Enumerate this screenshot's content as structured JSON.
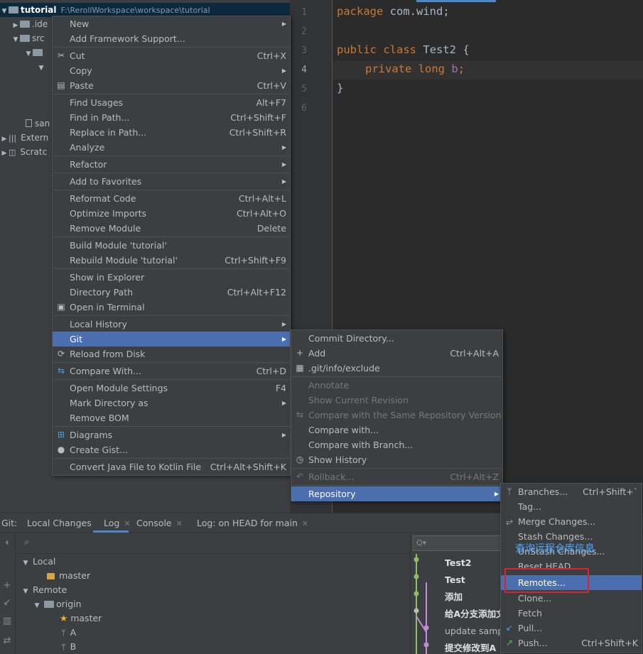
{
  "project": {
    "root_name": "tutorial",
    "root_path": "F:\\RerollWorkspace\\workspace\\tutorial",
    "items": [
      {
        "label": ".ide"
      },
      {
        "label": "src"
      },
      {
        "label": "san"
      },
      {
        "label": "Extern"
      },
      {
        "label": "Scratc"
      }
    ]
  },
  "editor": {
    "line_numbers": [
      "1",
      "2",
      "3",
      "4",
      "5",
      "6"
    ],
    "line1_kw": "package",
    "line1_rest": " com.wind;",
    "line3_kw1": "public",
    "line3_kw2": "class",
    "line3_name": "Test2",
    "line3_brace": " {",
    "line4_kw1": "private",
    "line4_kw2": "long",
    "line4_field": "b",
    "line4_end": ";",
    "line5": "}"
  },
  "main_menu": {
    "items": [
      {
        "label": "New",
        "shortcut": "",
        "submenu": true
      },
      {
        "label": "Add Framework Support...",
        "shortcut": ""
      },
      {
        "label": "Cut",
        "shortcut": "Ctrl+X",
        "icon": "scissors-icon"
      },
      {
        "label": "Copy",
        "shortcut": "",
        "submenu": true
      },
      {
        "label": "Paste",
        "shortcut": "Ctrl+V",
        "icon": "clipboard-icon"
      },
      {
        "label": "Find Usages",
        "shortcut": "Alt+F7"
      },
      {
        "label": "Find in Path...",
        "shortcut": "Ctrl+Shift+F"
      },
      {
        "label": "Replace in Path...",
        "shortcut": "Ctrl+Shift+R"
      },
      {
        "label": "Analyze",
        "shortcut": "",
        "submenu": true
      },
      {
        "label": "Refactor",
        "shortcut": "",
        "submenu": true
      },
      {
        "label": "Add to Favorites",
        "shortcut": "",
        "submenu": true
      },
      {
        "label": "Reformat Code",
        "shortcut": "Ctrl+Alt+L"
      },
      {
        "label": "Optimize Imports",
        "shortcut": "Ctrl+Alt+O"
      },
      {
        "label": "Remove Module",
        "shortcut": "Delete"
      },
      {
        "label": "Build Module 'tutorial'",
        "shortcut": ""
      },
      {
        "label": "Rebuild Module 'tutorial'",
        "shortcut": "Ctrl+Shift+F9"
      },
      {
        "label": "Show in Explorer",
        "shortcut": ""
      },
      {
        "label": "Directory Path",
        "shortcut": "Ctrl+Alt+F12"
      },
      {
        "label": "Open in Terminal",
        "shortcut": "",
        "icon": "terminal-icon"
      },
      {
        "label": "Local History",
        "shortcut": "",
        "submenu": true
      },
      {
        "label": "Git",
        "shortcut": "",
        "submenu": true,
        "selected": true
      },
      {
        "label": "Reload from Disk",
        "shortcut": "",
        "icon": "reload-icon"
      },
      {
        "label": "Compare With...",
        "shortcut": "Ctrl+D",
        "icon": "compare-icon"
      },
      {
        "label": "Open Module Settings",
        "shortcut": "F4"
      },
      {
        "label": "Mark Directory as",
        "shortcut": "",
        "submenu": true
      },
      {
        "label": "Remove BOM",
        "shortcut": ""
      },
      {
        "label": "Diagrams",
        "shortcut": "",
        "submenu": true,
        "icon": "diagram-icon"
      },
      {
        "label": "Create Gist...",
        "shortcut": "",
        "icon": "github-icon"
      },
      {
        "label": "Convert Java File to Kotlin File",
        "shortcut": "Ctrl+Alt+Shift+K"
      }
    ]
  },
  "git_menu": {
    "items": [
      {
        "label": "Commit Directory...",
        "shortcut": ""
      },
      {
        "label": "Add",
        "shortcut": "Ctrl+Alt+A",
        "icon": "plus-icon"
      },
      {
        "label": ".git/info/exclude",
        "shortcut": "",
        "icon": "git-file-icon"
      },
      {
        "label": "Annotate",
        "shortcut": "",
        "disabled": true
      },
      {
        "label": "Show Current Revision",
        "shortcut": "",
        "disabled": true
      },
      {
        "label": "Compare with the Same Repository Version",
        "shortcut": "",
        "disabled": true,
        "icon": "compare-icon"
      },
      {
        "label": "Compare with...",
        "shortcut": ""
      },
      {
        "label": "Compare with Branch...",
        "shortcut": ""
      },
      {
        "label": "Show History",
        "shortcut": "",
        "icon": "clock-icon"
      },
      {
        "label": "Rollback...",
        "shortcut": "Ctrl+Alt+Z",
        "disabled": true,
        "icon": "rollback-icon"
      },
      {
        "label": "Repository",
        "shortcut": "",
        "submenu": true,
        "selected": true
      }
    ]
  },
  "repo_menu": {
    "items": [
      {
        "label": "Branches...",
        "shortcut": "Ctrl+Shift+`",
        "icon": "branch-icon"
      },
      {
        "label": "Tag...",
        "shortcut": ""
      },
      {
        "label": "Merge Changes...",
        "shortcut": "",
        "icon": "merge-icon"
      },
      {
        "label": "Stash Changes...",
        "shortcut": ""
      },
      {
        "label": "UnStash Changes...",
        "shortcut": ""
      },
      {
        "label": "Reset HEAD...",
        "shortcut": ""
      },
      {
        "label": "Remotes...",
        "shortcut": "",
        "selected": true
      },
      {
        "label": "Clone...",
        "shortcut": ""
      },
      {
        "label": "Fetch",
        "shortcut": ""
      },
      {
        "label": "Pull...",
        "shortcut": "",
        "icon": "pull-icon"
      },
      {
        "label": "Push...",
        "shortcut": "Ctrl+Shift+K",
        "icon": "push-icon"
      }
    ]
  },
  "git_window": {
    "prefix": "Git:",
    "tabs": [
      {
        "label": "Local Changes",
        "closable": false
      },
      {
        "label": "Log",
        "closable": true,
        "active": true
      },
      {
        "label": "Console",
        "closable": true
      },
      {
        "label": "Log: on HEAD for main",
        "closable": true
      }
    ],
    "branches": {
      "local_label": "Local",
      "local_master": "master",
      "remote_label": "Remote",
      "origin": "origin",
      "remote_master": "master",
      "branch_a": "A",
      "branch_b": "B"
    },
    "filter_placeholder": "Q▾",
    "commits": [
      "Test2",
      "Test",
      "添加",
      "给A分支添加文",
      "update samp",
      "提交修改到A"
    ]
  },
  "annotation": {
    "text": "查询远程仓库信息",
    "color": "#4aa8ff",
    "box_color": "#e0202a"
  },
  "colors": {
    "selection": "#4b6eaf",
    "menu_bg": "#3c3f41",
    "editor_bg": "#2b2b2b",
    "keyword": "#cc7832"
  }
}
